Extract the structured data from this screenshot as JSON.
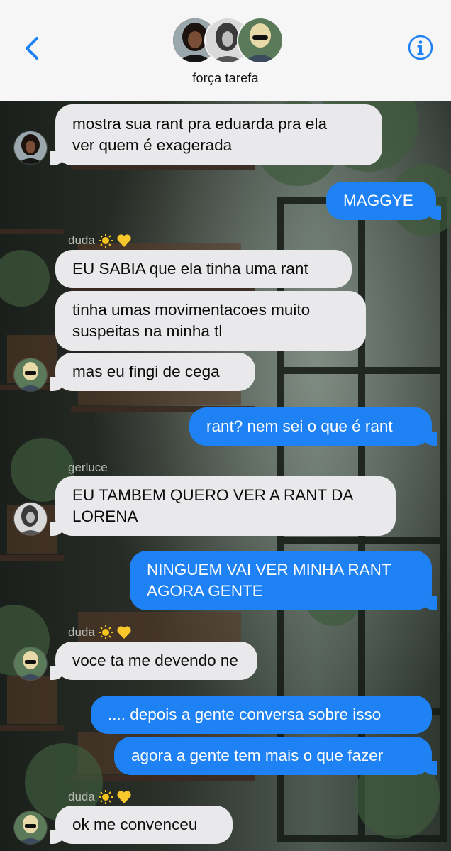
{
  "header": {
    "group_name": "força tarefa"
  },
  "colors": {
    "accent": "#1e82f5",
    "incoming_bubble": "#e9e9eb",
    "header_bg": "#f6f6f6"
  },
  "icons": {
    "back": "chevron-left-icon",
    "info": "info-icon",
    "sun": "sun-emoji",
    "heart": "yellow-heart-emoji"
  },
  "messages": [
    {
      "text": "mostra sua rant pra eduarda pra ela\nver quem é exagerada",
      "direction": "in"
    },
    {
      "text": "MAGGYE",
      "direction": "out"
    },
    {
      "sender": "duda",
      "text": "EU SABIA que ela tinha uma rant",
      "direction": "in"
    },
    {
      "text": "tinha umas movimentacoes muito\nsuspeitas na minha tl",
      "direction": "in"
    },
    {
      "text": "mas eu fingi de cega",
      "direction": "in"
    },
    {
      "text": "rant? nem sei o que é rant",
      "direction": "out"
    },
    {
      "sender": "gerluce",
      "text": "EU TAMBEM QUERO VER A RANT DA\nLORENA",
      "direction": "in"
    },
    {
      "text": "NINGUEM VAI VER MINHA RANT\nAGORA GENTE",
      "direction": "out"
    },
    {
      "sender": "duda",
      "text": "voce ta me devendo ne",
      "direction": "in"
    },
    {
      "text": ".... depois a gente conversa sobre isso",
      "direction": "out"
    },
    {
      "text": "agora a gente tem mais o que fazer",
      "direction": "out"
    },
    {
      "sender": "duda",
      "text": "ok me convenceu",
      "direction": "in"
    }
  ]
}
